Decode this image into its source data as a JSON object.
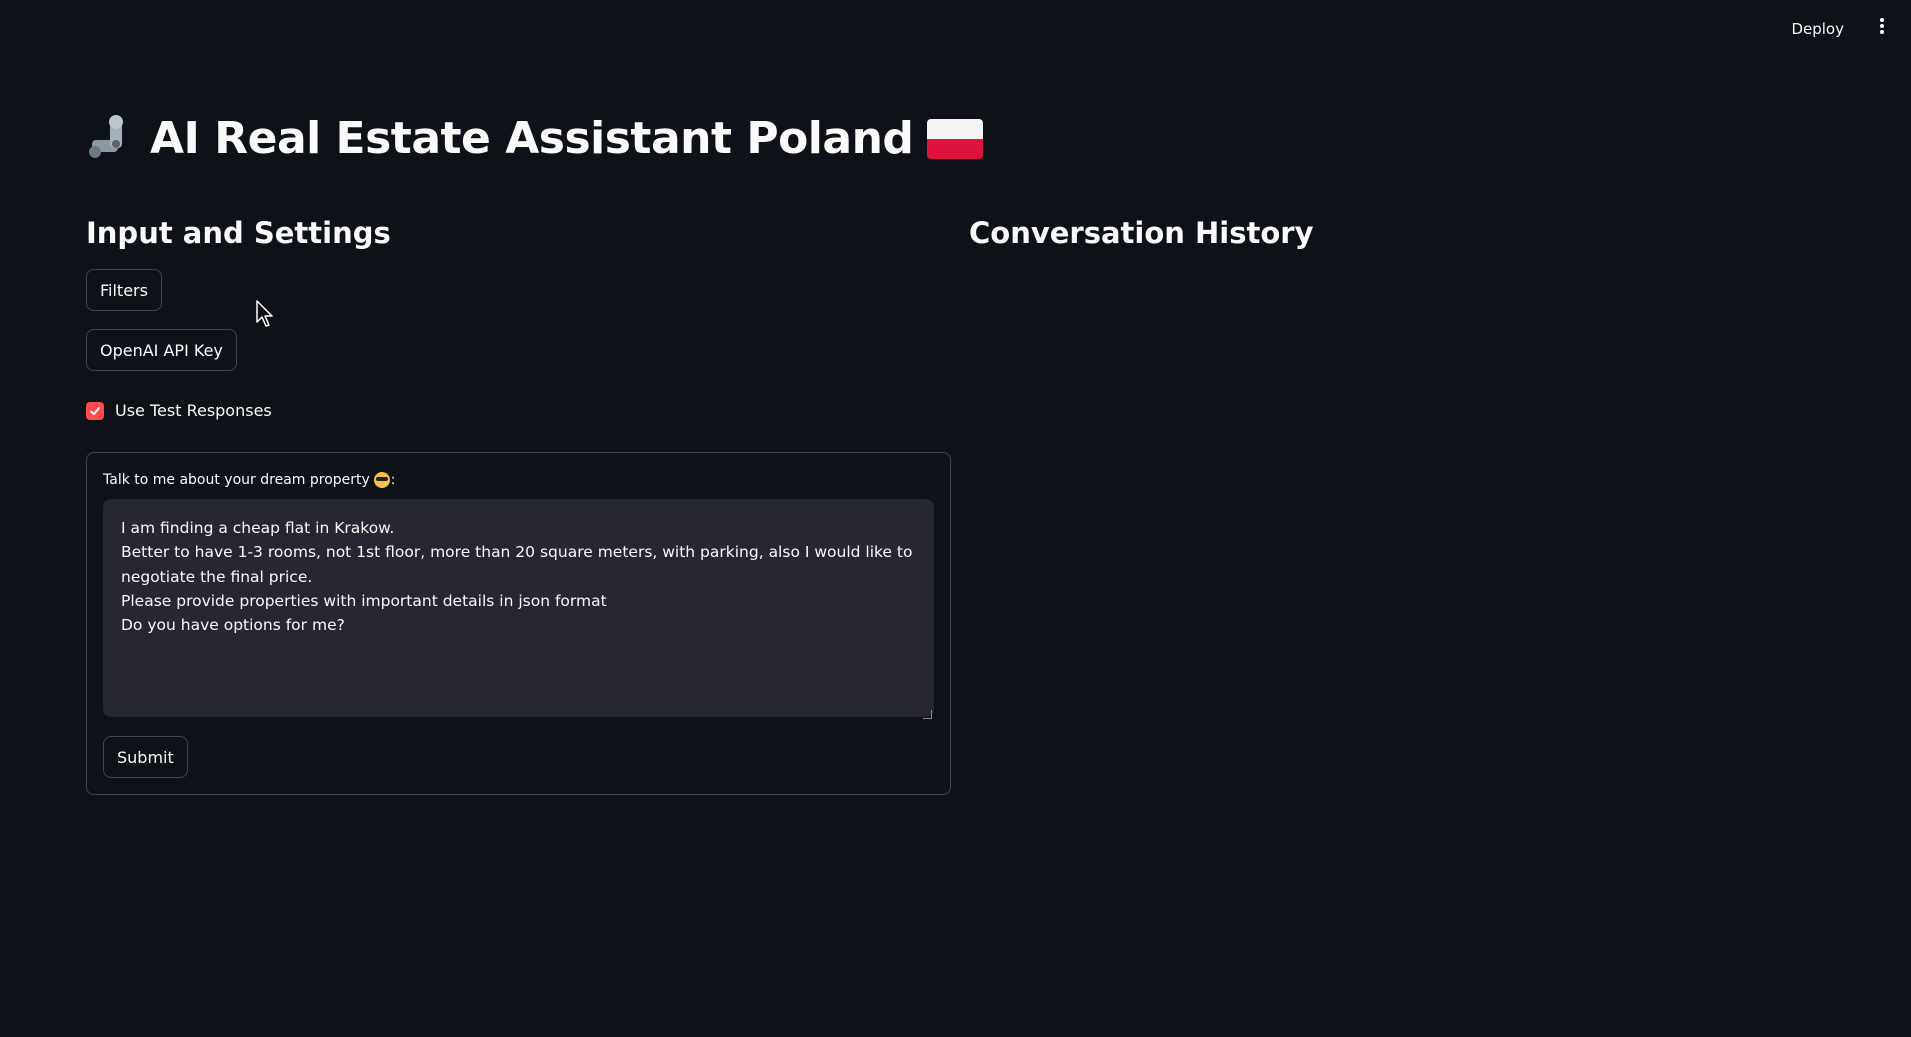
{
  "topbar": {
    "deploy_label": "Deploy",
    "menu_icon": "more-vertical-icon"
  },
  "title": {
    "text": "AI Real Estate Assistant Poland",
    "leading_icon": "mechanical-arm-icon",
    "trailing_icon": "poland-flag-icon"
  },
  "left_column": {
    "heading": "Input and Settings",
    "filters_button": "Filters",
    "api_key_button": "OpenAI API Key",
    "test_responses": {
      "label": "Use Test Responses",
      "checked": true
    },
    "form": {
      "label": "Talk to me about your dream property",
      "label_icon": "sunglasses-face-icon",
      "label_suffix": ":",
      "textarea_value": "I am finding a cheap flat in Krakow.\nBetter to have 1-3 rooms, not 1st floor, more than 20 square meters, with parking, also I would like to negotiate the final price.\nPlease provide properties with important details in json format\nDo you have options for me?",
      "submit_label": "Submit"
    }
  },
  "right_column": {
    "heading": "Conversation History"
  },
  "colors": {
    "background": "#0e1117",
    "text": "#fafafa",
    "accent": "#ff4b4b",
    "input_bg": "#262730"
  }
}
